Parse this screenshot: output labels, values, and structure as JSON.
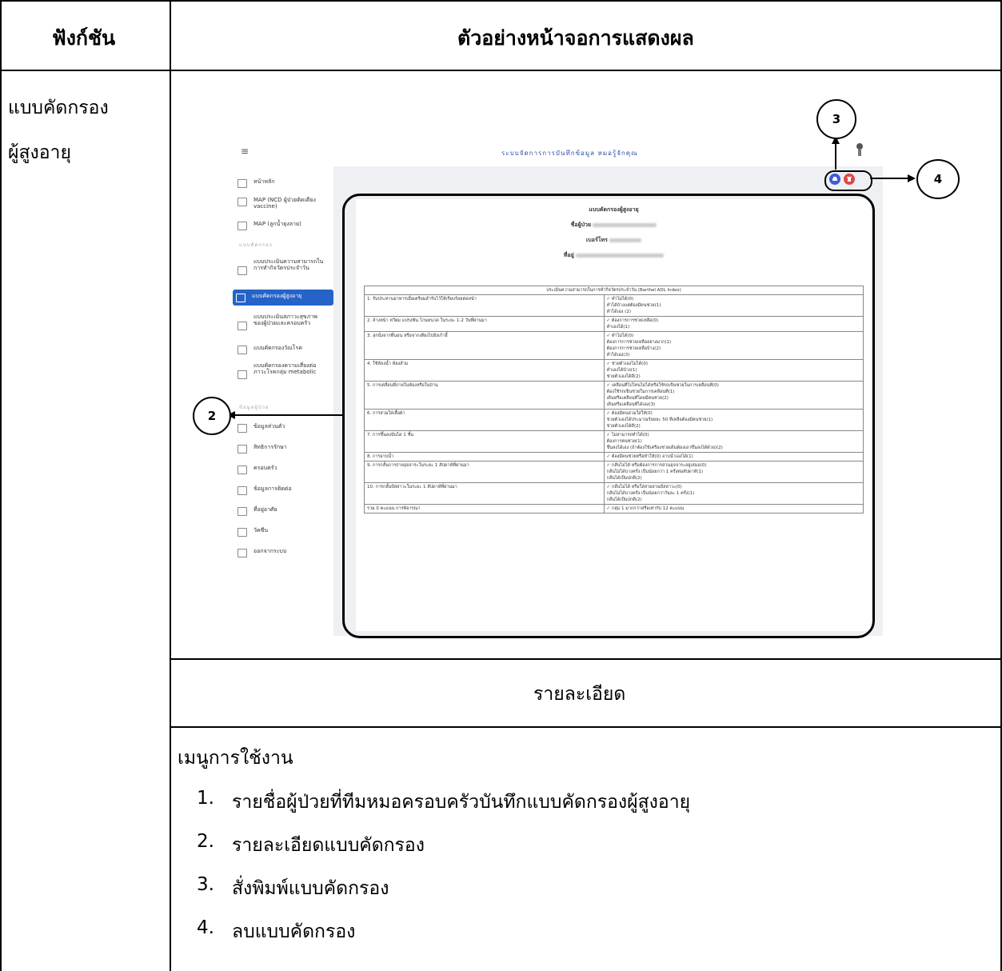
{
  "table": {
    "col1_header": "ฟังก์ชัน",
    "col2_header": "ตัวอย่างหน้าจอการแสดงผล",
    "function_line1": "แบบคัดกรอง",
    "function_line2": "ผู้สูงอายุ",
    "detail_header": "รายละเอียด",
    "menu_title": "เมนูการใช้งาน",
    "menu_items": [
      {
        "num": "1.",
        "text": "รายชื่อผู้ป่วยที่ทีมหมอครอบครัวบันทึกแบบคัดกรองผู้สูงอายุ"
      },
      {
        "num": "2.",
        "text": "รายละเอียดแบบคัดกรอง"
      },
      {
        "num": "3.",
        "text": "สั่งพิมพ์แบบคัดกรอง"
      },
      {
        "num": "4.",
        "text": "ลบแบบคัดกรอง"
      }
    ]
  },
  "callouts": [
    "2",
    "3",
    "4"
  ],
  "screenshot": {
    "app_title": "ระบบจัดการการบันทึกข้อมูล หมอรู้จักคุณ",
    "hamburger_icon": "≡",
    "sidebar": {
      "items_top": [
        "หน้าหลัก",
        "MAP (NCD ผู้ป่วยติดเตียง vaccine)",
        "MAP (ลูกน้ำยุงลาย)"
      ],
      "section1": "แบบคัดกรอง",
      "items_forms": [
        "แบบประเมินความสามารถในการทำกิจวัตรประจำวัน",
        "แบบคัดกรองผู้สูงอายุ",
        "แบบประเมินสภาวะสุขภาพของผู้ป่วยและครอบครัว",
        "แบบคัดกรองวัณโรค",
        "แบบคัดกรองความเสี่ยงต่อภาวะโรคกลุ่ม metabolic"
      ],
      "section2": "ข้อมูลผู้ป่วย",
      "items_patient": [
        "ข้อมูลส่วนตัว",
        "สิทธิการรักษา",
        "ครอบครัว",
        "ข้อมูลการติดต่อ",
        "ที่อยู่อาศัย",
        "วัคซีน",
        "ออกจากระบบ"
      ]
    },
    "form": {
      "title": "แบบคัดกรองผู้สูงอายุ",
      "name_label": "ชื่อผู้ป่วย",
      "phone_label": "เบอร์โทร",
      "address_label": "ที่อยู่",
      "table_title": "ประเมินความสามารถในการทำกิจวัตรประจำวัน (Barthel ADL Index)",
      "rows": [
        {
          "q": "1. รับประทานอาหารเมื่อเตรียมสำรับไว้ให้เรียบร้อยต่อหน้า",
          "opts": [
            "✓ ทำไม่ได้(0)",
            "ทำได้บ้างแต่ต้องมีคนช่วย(1)",
            "ทำได้เอง (2)"
          ]
        },
        {
          "q": "2. ล้างหน้า หวีผม แปรงฟัน โกนหนวด ในระยะ 1-2 วันที่ผ่านมา",
          "opts": [
            "✓ ต้องการการช่วยเหลือ(0)",
            "ทำเองได้(1)"
          ]
        },
        {
          "q": "3. ลุกนั่งจากที่นอน หรือจากเตียงไปยังเก้าอี้",
          "opts": [
            "✓ ทำไม่ได้(0)",
            "ต้องการการช่วยเหลืออย่างมาก(1)",
            "ต้องการการช่วยเหลือบ้าง(2)",
            "ทำได้เอง(3)"
          ]
        },
        {
          "q": "4. ใช้ห้องน้ำ ห้องส้วม",
          "opts": [
            "✓ ช่วยตัวเองไม่ได้(0)",
            "ทำเองได้บ้าง(1)",
            "ช่วยตัวเองได้ดี(2)"
          ]
        },
        {
          "q": "5. การเคลื่อนที่ภายในห้องหรือในบ้าน",
          "opts": [
            "✓ เคลื่อนที่ไปไหนไม่ได้หรือใช้รถเข็นช่วยในการเคลื่อนที่(0)",
            "ต้องใช้รถเข็นช่วยในการเคลื่อนที่(1)",
            "เดินหรือเคลื่อนที่โดยมีคนช่วย(2)",
            "เดินหรือเคลื่อนที่ได้เอง(3)"
          ]
        },
        {
          "q": "6. การสวมใส่เสื้อผ้า",
          "opts": [
            "✓ ต้องมีคนสวมใส่ให้(0)",
            "ช่วยตัวเองได้ประมาณร้อยละ 50 ที่เหลือต้องมีคนช่วย(1)",
            "ช่วยตัวเองได้ดี(2)"
          ]
        },
        {
          "q": "7. การขึ้นลงบันได 1 ชั้น",
          "opts": [
            "✓ ไม่สามารถทำได้(0)",
            "ต้องการคนช่วย(1)",
            "ขึ้นลงได้เอง (ถ้าต้องใช้เครื่องช่วยเดินต้องเอาขึ้นลงได้ด้วย)(2)"
          ]
        },
        {
          "q": "8. การอาบน้ำ",
          "opts": [
            "✓ ต้องมีคนช่วยหรือทำให้(0)   อาบน้ำเองได้(1)"
          ]
        },
        {
          "q": "9. การกลั้นการถ่ายอุจจาระในระยะ 1 สัปดาห์ที่ผ่านมา",
          "opts": [
            "✓ กลั้นไม่ได้ หรือต้องการการสวนอุจจาระอยู่เสมอ(0)",
            "กลั้นไม่ได้บางครั้ง เป็นน้อยกว่า 1 ครั้งต่อสัปดาห์(1)",
            "กลั้นได้เป็นปกติ(2)"
          ]
        },
        {
          "q": "10. การกลั้นปัสสาวะในระยะ 1 สัปดาห์ที่ผ่านมา",
          "opts": [
            "✓ กลั้นไม่ได้ หรือใส่สายสวนปัสสาวะ(0)",
            "กลั้นไม่ได้บางครั้ง เป็นน้อยกว่าวันละ 1 ครั้ง(1)",
            "กลั้นได้เป็นปกติ(2)"
          ]
        },
        {
          "q": "รวม 0 คะแนน การพิจารณา",
          "opts": [
            "✓ กลุ่ม 1 มากกว่าหรือเท่ากับ 12 คะแนน"
          ]
        }
      ]
    },
    "print_button_color": "#3f5bd8",
    "delete_button_color": "#e04848",
    "active_color": "#2563c9"
  }
}
